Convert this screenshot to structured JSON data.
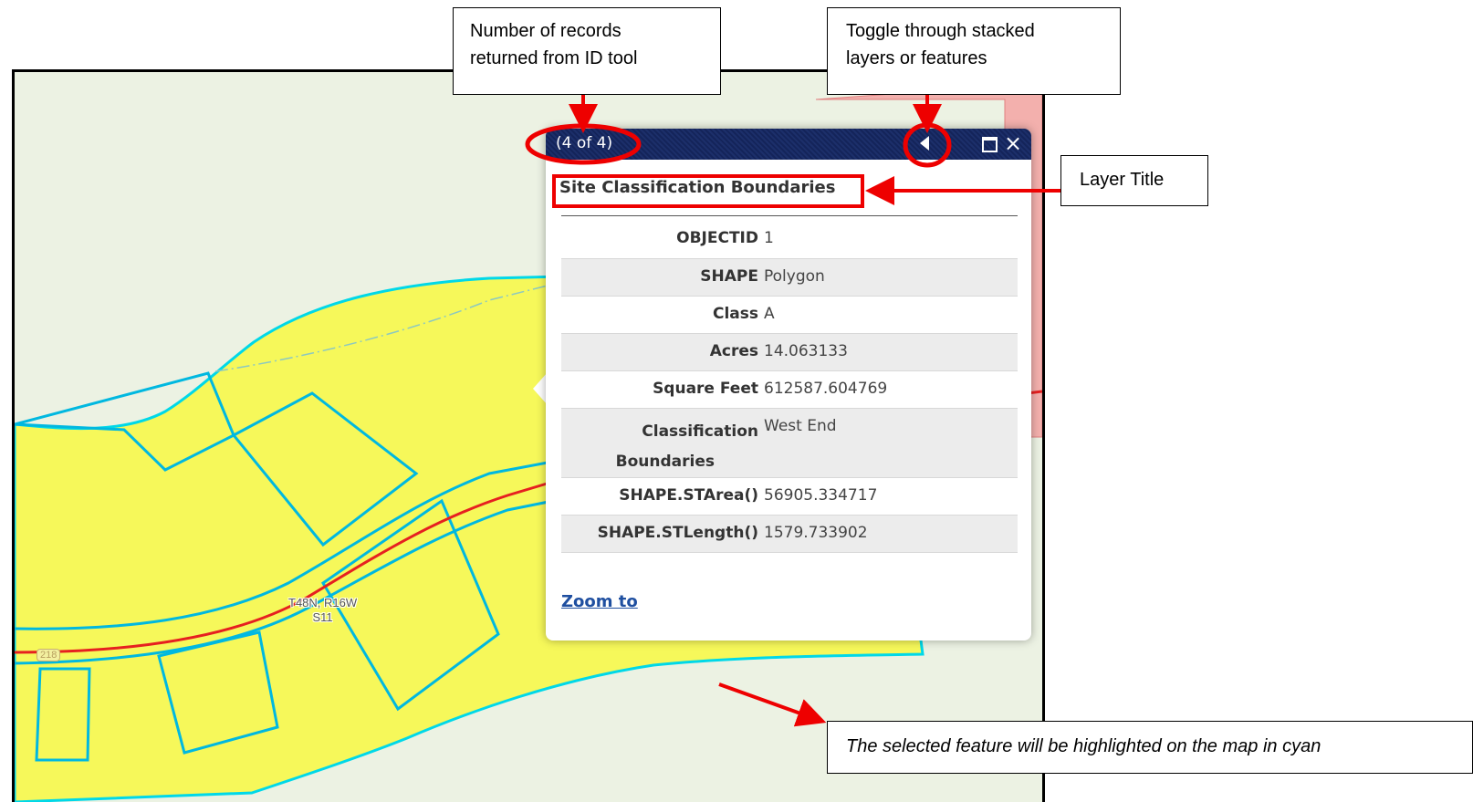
{
  "popup": {
    "count": "(4 of 4)",
    "layer_title": "Site Classification Boundaries",
    "attributes": [
      {
        "key": "OBJECTID",
        "value": "1"
      },
      {
        "key": "SHAPE",
        "value": "Polygon"
      },
      {
        "key": "Class",
        "value": "A"
      },
      {
        "key": "Acres",
        "value": "14.063133"
      },
      {
        "key": "Square Feet",
        "value": "612587.604769"
      },
      {
        "key_line1": "Classification",
        "key_line2": "Boundaries",
        "value": "West End"
      },
      {
        "key": "SHAPE.STArea()",
        "value": "56905.334717"
      },
      {
        "key": "SHAPE.STLength()",
        "value": "1579.733902"
      }
    ],
    "zoom_label": "Zoom to",
    "icons": {
      "prev": "triangle-left-icon",
      "maximize": "maximize-icon",
      "close": "close-icon"
    }
  },
  "map": {
    "section_label_line1": "T48N, R16W",
    "section_label_line2": "S11",
    "road_shield": "218"
  },
  "callouts": {
    "records_line1": "Number of records",
    "records_line2": "returned from ID tool",
    "toggle_line1": "Toggle through stacked",
    "toggle_line2": "layers or features",
    "layer_title": "Layer Title",
    "highlight": "The selected feature will be highlighted on the map in cyan"
  },
  "colors": {
    "highlight": "#00d8e8",
    "annotation": "#ee0000",
    "parcel_fill": "#f6f85a",
    "popup_header": "#1c2f6a"
  }
}
